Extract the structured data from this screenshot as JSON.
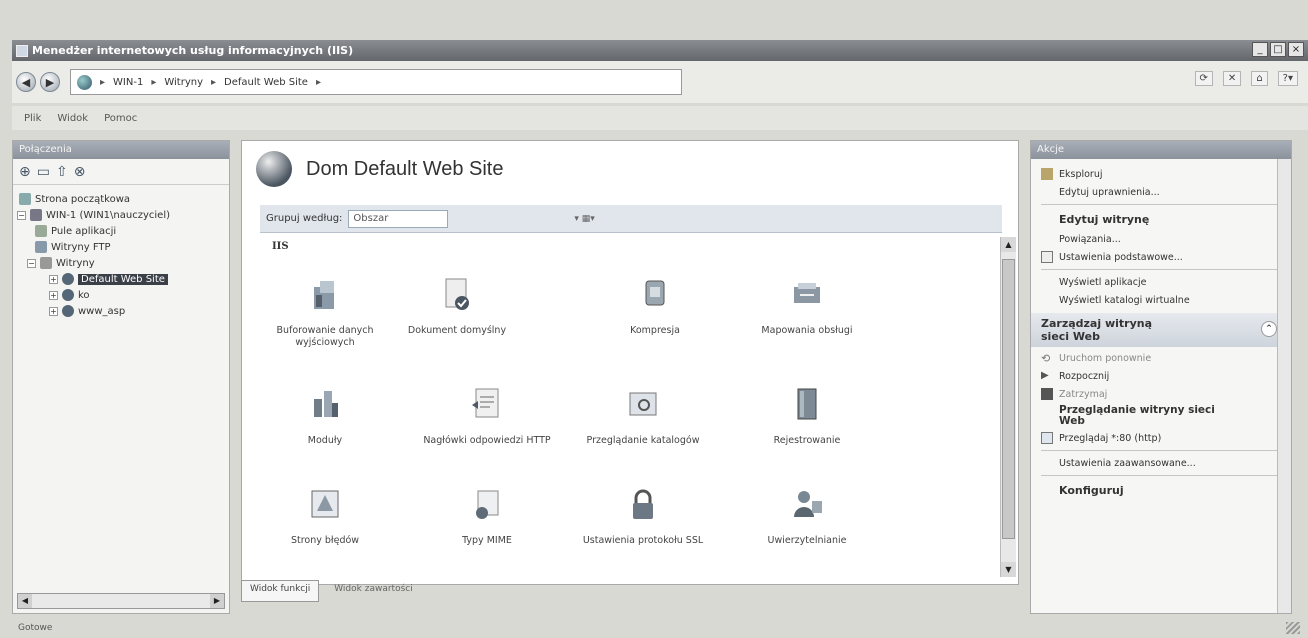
{
  "window": {
    "title": "Menedżer internetowych usług informacyjnych (IIS)"
  },
  "address": {
    "crumbs": [
      "WIN-1",
      "Witryny",
      "Default Web Site"
    ]
  },
  "menu": {
    "items": [
      "Plik",
      "Widok",
      "Pomoc"
    ]
  },
  "connections": {
    "header": "Połączenia",
    "tree": [
      {
        "label": "Strona początkowa"
      },
      {
        "label": "WIN-1 (WIN1\\nauczyciel)"
      },
      {
        "label": "Pule aplikacji"
      },
      {
        "label": "Witryny FTP"
      },
      {
        "label": "Witryny"
      },
      {
        "label": "Default Web Site"
      },
      {
        "label": "ko"
      },
      {
        "label": "www_asp"
      }
    ]
  },
  "home": {
    "title": "Dom Default Web Site",
    "group_label": "Grupuj według:",
    "group_value": "Obszar",
    "section": "IIS",
    "features": [
      {
        "label": "Buforowanie danych wyjściowych",
        "icon": "output-caching-icon"
      },
      {
        "label": "Dokument domyślny",
        "icon": "default-document-icon"
      },
      {
        "label": "Kompresja",
        "icon": "compression-icon"
      },
      {
        "label": "Mapowania obsługi",
        "icon": "handler-mappings-icon"
      },
      {
        "label": "Moduły",
        "icon": "modules-icon"
      },
      {
        "label": "Nagłówki odpowiedzi HTTP",
        "icon": "http-headers-icon"
      },
      {
        "label": "Przeglądanie katalogów",
        "icon": "directory-browsing-icon"
      },
      {
        "label": "Rejestrowanie",
        "icon": "logging-icon"
      },
      {
        "label": "Strony błędów",
        "icon": "error-pages-icon"
      },
      {
        "label": "Typy MIME",
        "icon": "mime-types-icon"
      },
      {
        "label": "Ustawienia protokołu SSL",
        "icon": "ssl-settings-icon"
      },
      {
        "label": "Uwierzytelnianie",
        "icon": "authentication-icon"
      }
    ]
  },
  "view_tabs": {
    "features": "Widok funkcji",
    "content": "Widok zawartości"
  },
  "actions": {
    "header": "Akcje",
    "explore": "Eksploruj",
    "edit_permissions": "Edytuj uprawnienia...",
    "edit_site": "Edytuj witrynę",
    "bindings": "Powiązania...",
    "basic_settings": "Ustawienia podstawowe...",
    "view_apps": "Wyświetl aplikacje",
    "view_vdirs": "Wyświetl katalogi wirtualne",
    "manage_site": "Zarządzaj witryną sieci Web",
    "restart": "Uruchom ponownie",
    "start": "Rozpocznij",
    "stop": "Zatrzymaj",
    "browse_head": "Przeglądanie witryny sieci Web",
    "browse_80": "Przeglądaj *:80 (http)",
    "advanced": "Ustawienia zaawansowane...",
    "configure": "Konfiguruj"
  },
  "status": "Gotowe",
  "colors": {
    "accent": "#3a3f48",
    "titlebar": "#63666b"
  }
}
